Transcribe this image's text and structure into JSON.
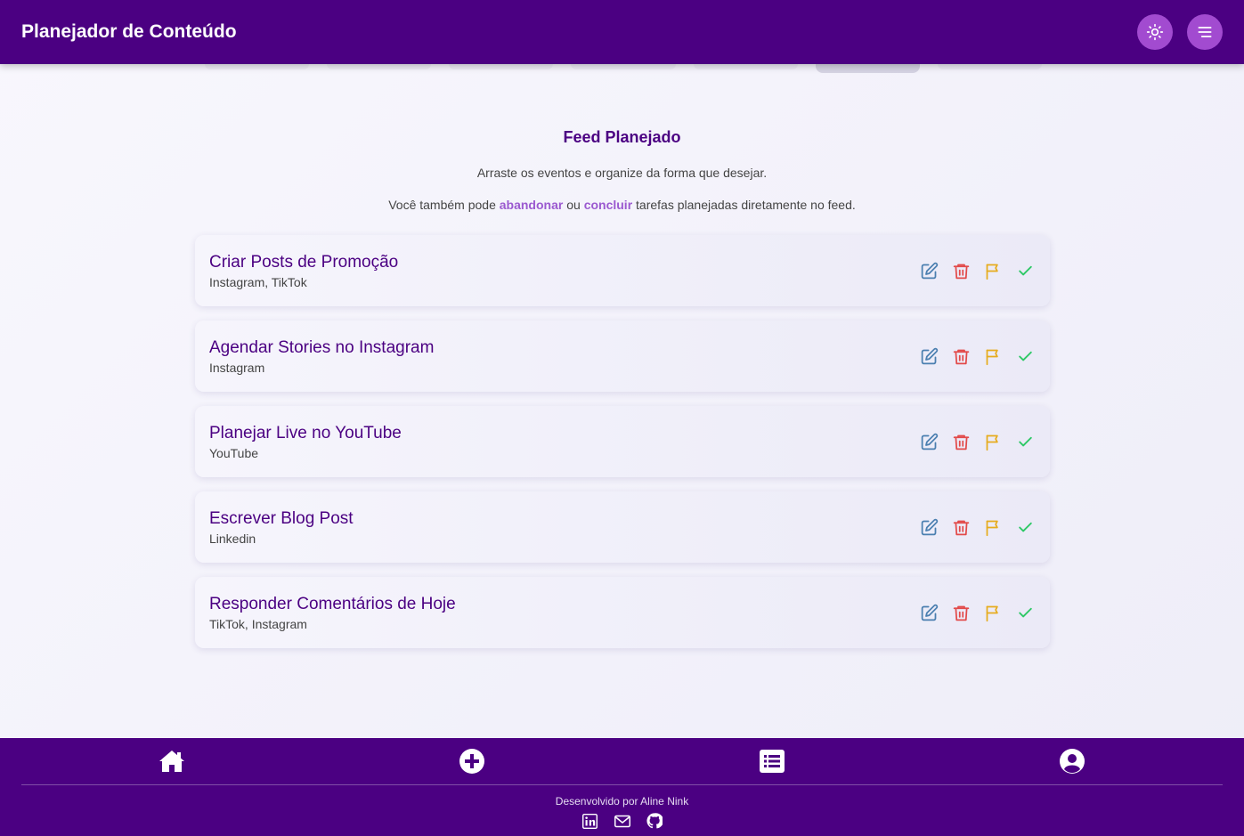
{
  "app": {
    "title": "Planejador de Conteúdo"
  },
  "header": {
    "theme_icon": "sun-icon",
    "menu_icon": "menu-icon"
  },
  "feed": {
    "heading": "Feed Planejado",
    "description": "Arraste os eventos e organize da forma que desejar.",
    "hint_before": "Você também pode ",
    "hint_abandon": "abandonar",
    "hint_middle": " ou ",
    "hint_complete": "concluir",
    "hint_after": " tarefas planejadas diretamente no feed.",
    "items": [
      {
        "title": "Criar Posts de Promoção",
        "platforms": "Instagram, TikTok"
      },
      {
        "title": "Agendar Stories no Instagram",
        "platforms": "Instagram"
      },
      {
        "title": "Planejar Live no YouTube",
        "platforms": "YouTube"
      },
      {
        "title": "Escrever Blog Post",
        "platforms": "Linkedin"
      },
      {
        "title": "Responder Comentários de Hoje",
        "platforms": "TikTok, Instagram"
      }
    ],
    "action_icons": [
      "edit-icon",
      "trash-icon",
      "flag-icon",
      "check-icon"
    ]
  },
  "colors": {
    "primary": "#4b0082",
    "accent": "#a24bd0",
    "edit": "#4a7fb0",
    "delete": "#e24a4a",
    "flag": "#e6ac1e",
    "complete": "#2ec866"
  },
  "footer": {
    "nav_icons": [
      "home-icon",
      "plus-circle-icon",
      "list-icon",
      "user-circle-icon"
    ],
    "credit": "Desenvolvido por Aline Nink",
    "social_icons": [
      "linkedin-icon",
      "mail-icon",
      "github-icon"
    ]
  }
}
